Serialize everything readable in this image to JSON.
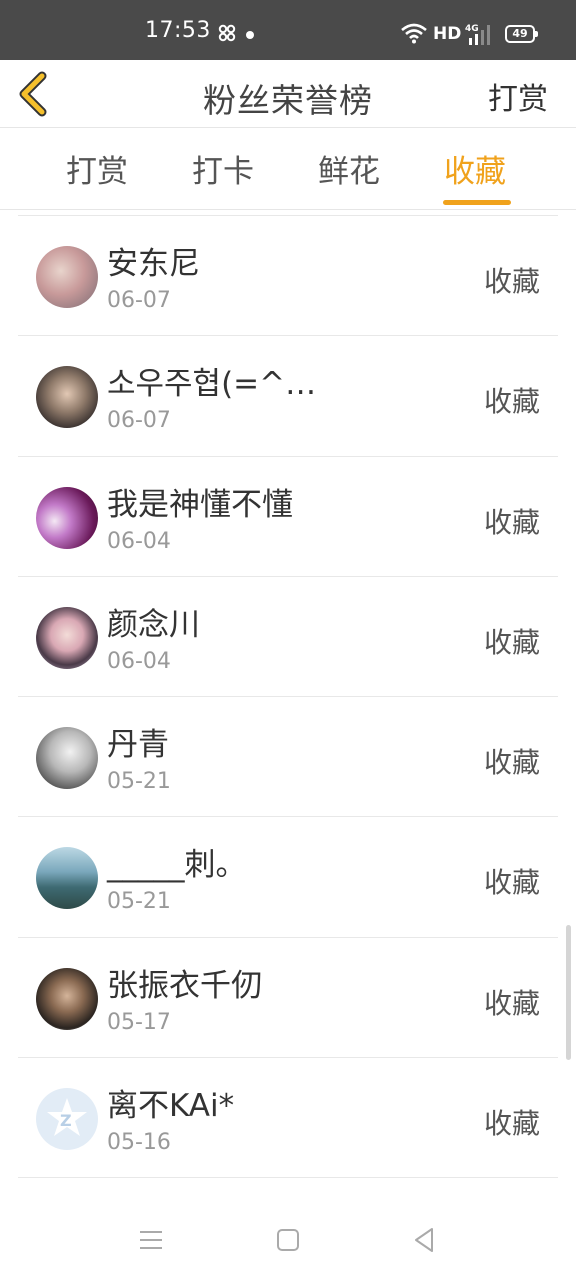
{
  "status_bar": {
    "time": "17:53",
    "hd": "HD",
    "network": "4G",
    "battery": "49"
  },
  "header": {
    "title": "粉丝荣誉榜",
    "action": "打赏"
  },
  "tabs": [
    {
      "label": "打赏",
      "active": false
    },
    {
      "label": "打卡",
      "active": false
    },
    {
      "label": "鲜花",
      "active": false
    },
    {
      "label": "收藏",
      "active": true
    }
  ],
  "accent_color": "#f0a21c",
  "list": [
    {
      "name": "安东尼",
      "date": "06-07",
      "action": "收藏"
    },
    {
      "name": "소우주협(=^…",
      "date": "06-07",
      "action": "收藏"
    },
    {
      "name": "我是神懂不懂",
      "date": "06-04",
      "action": "收藏"
    },
    {
      "name": "颜念川",
      "date": "06-04",
      "action": "收藏"
    },
    {
      "name": "丹青",
      "date": "05-21",
      "action": "收藏"
    },
    {
      "name": "_____刺。",
      "date": "05-21",
      "action": "收藏"
    },
    {
      "name": "张振衣千仞",
      "date": "05-17",
      "action": "收藏"
    },
    {
      "name": "离不KAi*",
      "date": "05-16",
      "action": "收藏"
    }
  ]
}
